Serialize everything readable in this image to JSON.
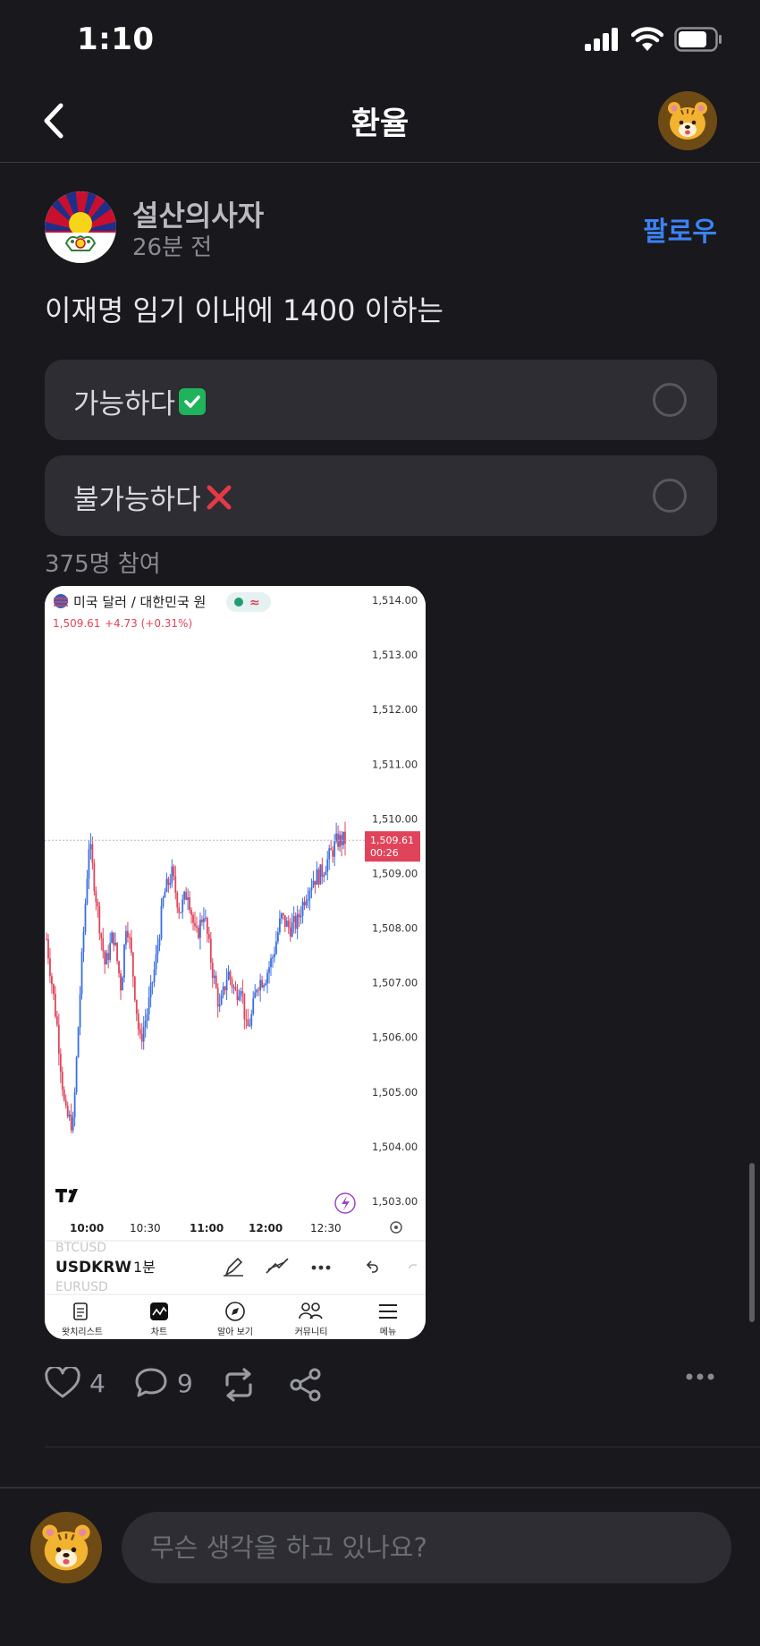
{
  "status": {
    "time": "1:10"
  },
  "nav": {
    "title": "환율"
  },
  "post": {
    "author": "설산의사자",
    "time": "26분 전",
    "follow_label": "팔로우",
    "text": "이재명 임기 이내에 1400 이하는",
    "poll": {
      "options": [
        {
          "label": "가능하다",
          "icon": "check-mark-icon"
        },
        {
          "label": "불가능하다",
          "icon": "x-mark-icon"
        }
      ],
      "participants": "375명 참여"
    },
    "likes": "4",
    "comments": "9"
  },
  "chart_screenshot": {
    "pair_title": "미국 달러 / 대한민국 원",
    "price_line": "1,509.61",
    "change": "+4.73 (+0.31%)",
    "last_price": "1,509.61",
    "countdown": "00:26",
    "symbol": "USDKRW",
    "interval": "1분",
    "ghost_symbol_top": "BTCUSD",
    "ghost_symbol_bottom": "EURUSD",
    "nav_tabs": [
      "왓치리스트",
      "차트",
      "알아 보기",
      "커뮤니티",
      "메뉴"
    ]
  },
  "chart_data": {
    "type": "candlestick",
    "x_tick_labels": [
      "10:00",
      "10:30",
      "11:00",
      "12:00",
      "12:30"
    ],
    "y_tick_labels": [
      "1,514.00",
      "1,513.00",
      "1,512.00",
      "1,511.00",
      "1,510.00",
      "1,509.00",
      "1,508.00",
      "1,507.00",
      "1,506.00",
      "1,505.00",
      "1,504.00",
      "1,503.00"
    ],
    "ylim": [
      1503,
      1514
    ],
    "last": 1509.61,
    "up_color": "#3b6fe0",
    "down_color": "#e0445a",
    "close_path": [
      [
        0,
        1507.8
      ],
      [
        4,
        1506.2
      ],
      [
        7,
        1504.6
      ],
      [
        10,
        1504.4
      ],
      [
        13,
        1507.2
      ],
      [
        16,
        1509.6
      ],
      [
        19,
        1508.4
      ],
      [
        22,
        1507.3
      ],
      [
        25,
        1507.9
      ],
      [
        28,
        1506.9
      ],
      [
        30,
        1508.2
      ],
      [
        32,
        1507.4
      ],
      [
        35,
        1505.9
      ],
      [
        38,
        1506.5
      ],
      [
        41,
        1507.4
      ],
      [
        44,
        1508.6
      ],
      [
        47,
        1509.0
      ],
      [
        50,
        1508.3
      ],
      [
        53,
        1508.7
      ],
      [
        56,
        1507.8
      ],
      [
        59,
        1508.3
      ],
      [
        62,
        1507.3
      ],
      [
        65,
        1506.5
      ],
      [
        68,
        1507.2
      ],
      [
        71,
        1506.8
      ],
      [
        73,
        1507.0
      ],
      [
        75,
        1506.1
      ],
      [
        77,
        1506.4
      ],
      [
        79,
        1507.0
      ],
      [
        82,
        1507.1
      ],
      [
        85,
        1507.5
      ],
      [
        88,
        1508.2
      ],
      [
        91,
        1508.0
      ],
      [
        94,
        1508.1
      ],
      [
        97,
        1508.6
      ],
      [
        100,
        1508.9
      ],
      [
        103,
        1509.0
      ],
      [
        106,
        1509.3
      ],
      [
        109,
        1509.6
      ],
      [
        112,
        1509.61
      ]
    ]
  },
  "composer": {
    "placeholder": "무슨 생각을 하고 있나요?"
  },
  "colors": {
    "accent": "#3b82f6",
    "background": "#18181d",
    "card": "#2d2d33",
    "price_tag": "#e0445a"
  }
}
